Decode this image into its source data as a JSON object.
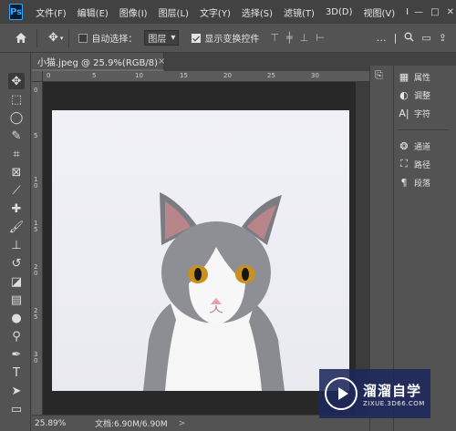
{
  "app": {
    "logo": "Ps"
  },
  "menu": [
    "文件(F)",
    "编辑(E)",
    "图像(I)",
    "图层(L)",
    "文字(Y)",
    "选择(S)",
    "滤镜(T)",
    "3D(D)",
    "视图(V)",
    "I"
  ],
  "window_controls": {
    "minimize": "—",
    "maximize": "□",
    "close": "✕"
  },
  "options": {
    "auto_select_label": "自动选择：",
    "auto_select_checked": false,
    "layer_select_value": "图层",
    "show_transform_label": "显示变换控件",
    "show_transform_checked": true,
    "more": "…"
  },
  "document": {
    "tab_title": "小猫.jpeg @ 25.9%(RGB/8)",
    "tab_close": "×",
    "zoom_status": "25.89%",
    "doc_status": "文档:6.90M/6.90M",
    "status_arrow": ">"
  },
  "rulers": {
    "h": [
      "0",
      "5",
      "10",
      "15",
      "20",
      "25",
      "30"
    ],
    "v": [
      "0",
      "5",
      "10",
      "15",
      "20",
      "25",
      "30"
    ]
  },
  "panels": {
    "group1": [
      {
        "icon": "info-icon",
        "label": "属性"
      },
      {
        "icon": "adjust-icon",
        "label": "调整"
      },
      {
        "icon": "character-icon",
        "label": "字符"
      }
    ],
    "group2": [
      {
        "icon": "channels-icon",
        "label": "通道"
      },
      {
        "icon": "paths-icon",
        "label": "路径"
      },
      {
        "icon": "paragraph-icon",
        "label": "段落"
      }
    ]
  },
  "watermark": {
    "title": "溜溜自学",
    "subtitle": "ZIXUE.3D66.COM"
  },
  "colors": {
    "menubar": "#424242",
    "workspace": "#535353",
    "canvas_bg": "#282828",
    "accent": "#31a8ff"
  }
}
